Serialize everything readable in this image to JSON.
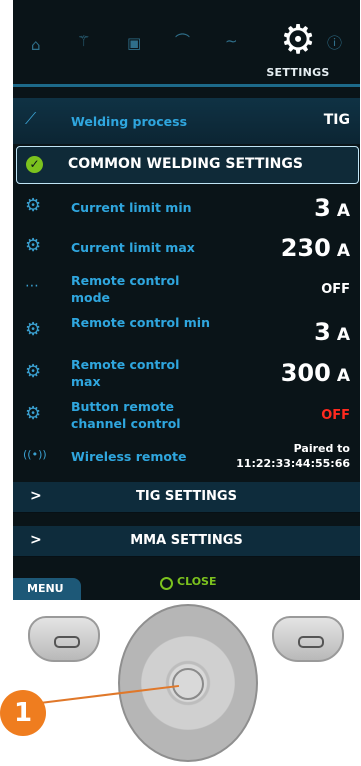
{
  "topbar": {
    "tabs": [
      {
        "icon": "home-icon",
        "glyph": "⌂"
      },
      {
        "icon": "wand-icon",
        "glyph": "⚚"
      },
      {
        "icon": "memory-icon",
        "glyph": "▣"
      },
      {
        "icon": "curve-icon",
        "glyph": "⌒"
      },
      {
        "icon": "wave-icon",
        "glyph": "∼"
      }
    ],
    "settings_glyph": "⚙",
    "settings_label": "SETTINGS",
    "info_glyph": "ⓘ"
  },
  "process": {
    "label": "Welding process",
    "value": "TIG"
  },
  "common_header": {
    "check": "✓",
    "title": "COMMON WELDING SETTINGS"
  },
  "settings": [
    {
      "icon": "gear-icon",
      "glyph": "⚙",
      "label": "Current limit min",
      "value": "3",
      "unit": "A"
    },
    {
      "icon": "gear-icon",
      "glyph": "⚙",
      "label": "Current limit max",
      "value": "230",
      "unit": "A"
    },
    {
      "icon": "remote-icon",
      "glyph": "⋯",
      "label": "Remote control mode",
      "value": "OFF",
      "unit": ""
    },
    {
      "icon": "gear-icon",
      "glyph": "⚙",
      "label": "Remote control min",
      "value": "3",
      "unit": "A"
    },
    {
      "icon": "gear-icon",
      "glyph": "⚙",
      "label": "Remote control max",
      "value": "300",
      "unit": "A"
    },
    {
      "icon": "gear-icon",
      "glyph": "⚙",
      "label": "Button remote channel control",
      "value": "OFF",
      "unit": "",
      "color": "#ff2a1f"
    }
  ],
  "wireless": {
    "glyph": "((•))",
    "label": "Wireless remote",
    "status": "Paired to",
    "address": "11:22:33:44:55:66"
  },
  "sections": [
    {
      "chevron": ">",
      "title": "TIG SETTINGS"
    },
    {
      "chevron": ">",
      "title": "MMA SETTINGS"
    }
  ],
  "bottom": {
    "menu": "MENU",
    "close": "CLOSE"
  },
  "hardware": {
    "callout": "1"
  },
  "colors": {
    "accent": "#2fa6de",
    "ok": "#7cc21e",
    "alert": "#ff2a1f",
    "callout": "#ef7d1f"
  }
}
